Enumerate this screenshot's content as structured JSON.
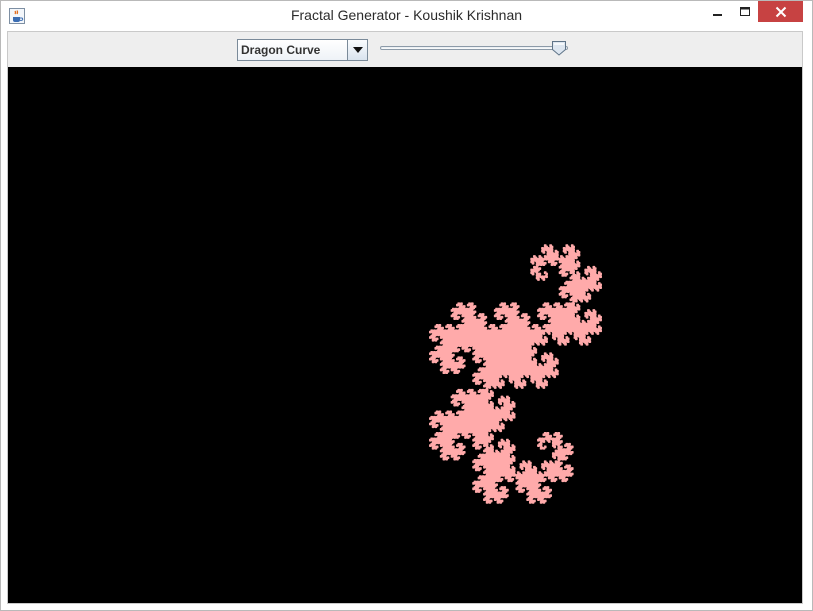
{
  "window": {
    "title": "Fractal Generator - Koushik Krishnan",
    "app_icon": "java-cup-icon",
    "controls": {
      "minimize_icon": "minimize-icon",
      "maximize_icon": "maximize-icon",
      "close_icon": "close-icon"
    }
  },
  "toolbar": {
    "fractal_select": {
      "selected": "Dragon Curve",
      "arrow_icon": "chevron-down-icon"
    },
    "iteration_slider": {
      "value_fraction": 0.95
    }
  },
  "canvas": {
    "background_color": "#000000",
    "fractal_color": "#ffaaaa",
    "fractal_type": "dragon-curve"
  }
}
